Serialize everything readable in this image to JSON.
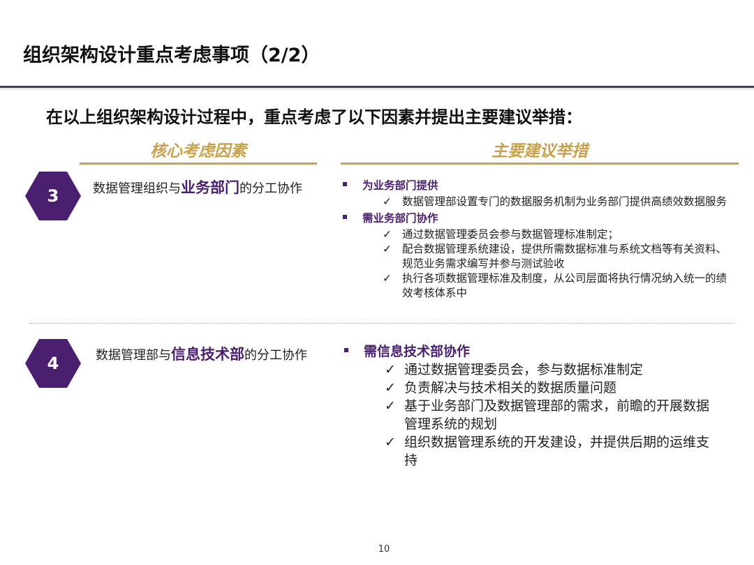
{
  "title": "组织架构设计重点考虑事项（2/2）",
  "subtitle": "在以上组织架构设计过程中，重点考虑了以下因素并提出主要建议举措：",
  "columns": {
    "left": "核心考虑因素",
    "right": "主要建议举措"
  },
  "rows": [
    {
      "number": "3",
      "factor": {
        "pre": "数据管理组织与",
        "highlight": "业务部门",
        "post": "的分工协作"
      },
      "groups": [
        {
          "heading": "为业务部门提供",
          "items": [
            "数据管理部设置专门的数据服务机制为业务部门提供高绩效数据服务"
          ]
        },
        {
          "heading": "需业务部门协作",
          "items": [
            "通过数据管理委员会参与数据管理标准制定；",
            "配合数据管理系统建设，提供所需数据标准与系统文档等有关资料、规范业务需求编写并参与测试验收",
            "执行各项数据管理标准及制度，从公司层面将执行情况纳入统一的绩效考核体系中"
          ]
        }
      ]
    },
    {
      "number": "4",
      "factor": {
        "pre": "数据管理部与",
        "highlight": "信息技术部",
        "post": "的分工协作"
      },
      "groups": [
        {
          "heading": "需信息技术部协作",
          "items": [
            "通过数据管理委员会，参与数据标准制定",
            "负责解决与技术相关的数据质量问题",
            "基于业务部门及数据管理部的需求，前瞻的开展数据管理系统的规划",
            "组织数据管理系统的开发建设，并提供后期的运维支持"
          ]
        }
      ]
    }
  ],
  "check_symbol": "✓",
  "page_number": "10",
  "colors": {
    "purple": "#4b1f6f",
    "gold": "#c8a24a",
    "navy_rule": "#3d3b6e"
  }
}
